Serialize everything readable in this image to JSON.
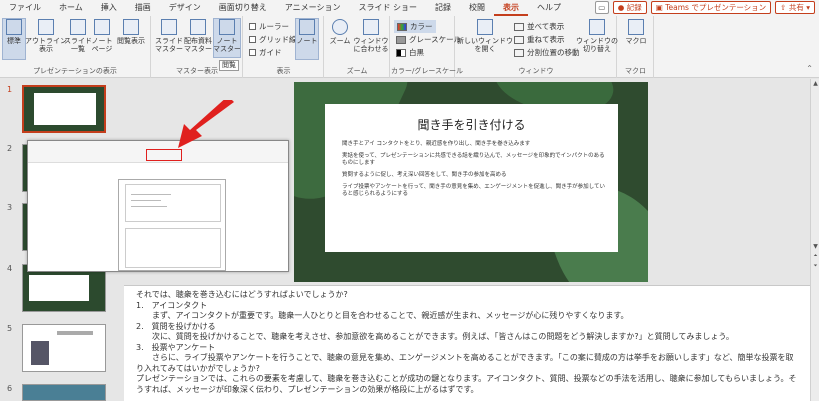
{
  "menu": {
    "tabs": [
      "ファイル",
      "ホーム",
      "挿入",
      "描画",
      "デザイン",
      "画面切り替え",
      "アニメーション",
      "スライド ショー",
      "記録",
      "校閲",
      "表示",
      "ヘルプ"
    ],
    "active_tab": "表示",
    "record_label": "記録",
    "teams_label": "Teams でプレゼンテーション",
    "share_label": "共有"
  },
  "ribbon": {
    "presentation_views": {
      "label": "プレゼンテーションの表示",
      "normal": "標準",
      "outline": "アウトライン\n表示",
      "slide_sorter": "スライド\n一覧",
      "notes_page": "ノート\nページ",
      "reading_view": "閲覧表示"
    },
    "master_views": {
      "label": "マスター表示",
      "slide_master": "スライド\nマスター",
      "handout_master": "配布資料\nマスター",
      "notes_master": "ノート\nマスター"
    },
    "show": {
      "label": "表示",
      "ruler": "ルーラー",
      "gridlines": "グリッド線",
      "guides": "ガイド",
      "notes": "ノート"
    },
    "zoom": {
      "label": "ズーム",
      "zoom": "ズーム",
      "fit": "ウィンドウ\nに合わせる"
    },
    "color": {
      "label": "カラー/グレースケール",
      "color": "カラー",
      "grayscale": "グレースケール",
      "bw": "白黒"
    },
    "window": {
      "label": "ウィンドウ",
      "new_window": "新しいウィンドウ\nを開く",
      "arrange": "並べて表示",
      "cascade": "重ねて表示",
      "split": "分割位置の移動",
      "switch": "ウィンドウの\n切り替え"
    },
    "macro": {
      "label": "マクロ",
      "macros": "マクロ"
    }
  },
  "tooltip": "閲覧",
  "thumbnails": {
    "numbers": [
      "1",
      "2",
      "3",
      "4",
      "5",
      "6"
    ]
  },
  "slide": {
    "title": "聞き手を引き付ける",
    "bullets": [
      "聞き手とアイ コンタクトをとり、親近感を作り出し、聞き手を巻き込みます",
      "実話を使って、プレゼンテーションに共感できる話を織り込んで、メッセージを印象的でインパクトのあるものにします",
      "質問するように促し、考え深い回答をして、聞き手の参加を高める",
      "ライブ投票やアンケートを行って、聞き手の意見を集め、エンゲージメントを促進し、聞き手が参加していると感じられるようにする"
    ]
  },
  "notes": {
    "lines": [
      "それでは、聴衆を巻き込むにはどうすればよいでしょうか?",
      "1.　アイコンタクト",
      "　　まず、アイコンタクトが重要です。聴衆一人ひとりと目を合わせることで、親近感が生まれ、メッセージが心に残りやすくなります。",
      "2.　質問を投げかける",
      "　　次に、質問を投げかけることで、聴衆を考えさせ、参加意欲を高めることができます。例えば、「皆さんはこの問題をどう解決しますか?」と質問してみましょう。",
      "3.　投票やアンケート",
      "　　さらに、ライブ投票やアンケートを行うことで、聴衆の意見を集め、エンゲージメントを高めることができます。「この案に賛成の方は挙手をお願いします」など、簡単な投票を取り入れてみてはいかがでしょうか?",
      "プレゼンテーションでは、これらの要素を考慮して、聴衆を巻き込むことが成功の鍵となります。アイコンタクト、質問、投票などの手法を活用し、聴衆に参加してもらいましょう。そうすれば、メッセージが印象深く伝わり、プレゼンテーションの効果が格段に上がるはずです。"
    ]
  },
  "colors": {
    "accent": "#c43e1c",
    "arrow": "#e0201e"
  }
}
